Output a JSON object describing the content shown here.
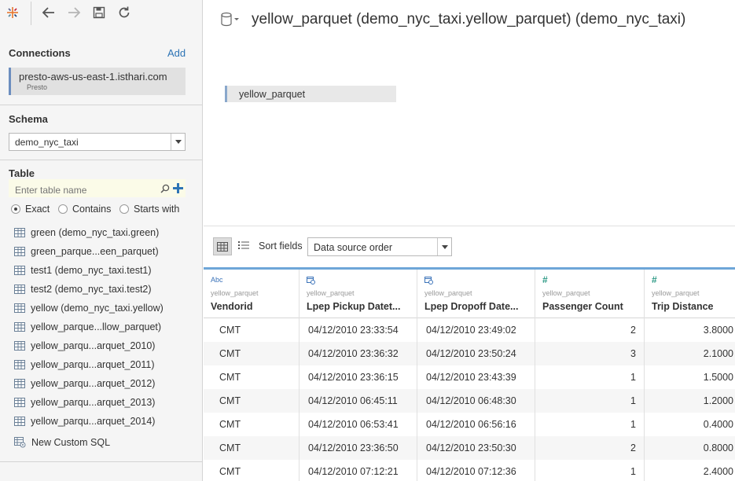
{
  "datasource_title": "yellow_parquet (demo_nyc_taxi.yellow_parquet) (demo_nyc_taxi)",
  "connections": {
    "heading": "Connections",
    "add_label": "Add",
    "items": [
      {
        "name": "presto-aws-us-east-1.isthari.com",
        "type": "Presto"
      }
    ]
  },
  "schema": {
    "heading": "Schema",
    "selected": "demo_nyc_taxi"
  },
  "table": {
    "heading": "Table",
    "search_placeholder": "Enter table name",
    "match_options": [
      "Exact",
      "Contains",
      "Starts with"
    ],
    "selected_match": "Exact",
    "items": [
      "green (demo_nyc_taxi.green)",
      "green_parque...een_parquet)",
      "test1 (demo_nyc_taxi.test1)",
      "test2 (demo_nyc_taxi.test2)",
      "yellow (demo_nyc_taxi.yellow)",
      "yellow_parque...llow_parquet)",
      "yellow_parqu...arquet_2010)",
      "yellow_parqu...arquet_2011)",
      "yellow_parqu...arquet_2012)",
      "yellow_parqu...arquet_2013)",
      "yellow_parqu...arquet_2014)"
    ],
    "custom_sql_label": "New Custom SQL"
  },
  "canvas": {
    "table_name": "yellow_parquet"
  },
  "grid": {
    "sort_label": "Sort fields",
    "sort_selected": "Data source order",
    "columns": [
      {
        "type": "Abc",
        "source": "yellow_parquet",
        "name": "Vendorid",
        "kind": "string"
      },
      {
        "type": "",
        "source": "yellow_parquet",
        "name": "Lpep Pickup Datet...",
        "kind": "datetime"
      },
      {
        "type": "",
        "source": "yellow_parquet",
        "name": "Lpep Dropoff Date...",
        "kind": "datetime"
      },
      {
        "type": "",
        "source": "yellow_parquet",
        "name": "Passenger Count",
        "kind": "number"
      },
      {
        "type": "",
        "source": "yellow_parquet",
        "name": "Trip Distance",
        "kind": "number"
      }
    ],
    "rows": [
      [
        "CMT",
        "04/12/2010 23:33:54",
        "04/12/2010 23:49:02",
        "2",
        "3.8000"
      ],
      [
        "CMT",
        "04/12/2010 23:36:32",
        "04/12/2010 23:50:24",
        "3",
        "2.1000"
      ],
      [
        "CMT",
        "04/12/2010 23:36:15",
        "04/12/2010 23:43:39",
        "1",
        "1.5000"
      ],
      [
        "CMT",
        "04/12/2010 06:45:11",
        "04/12/2010 06:48:30",
        "1",
        "1.2000"
      ],
      [
        "CMT",
        "04/12/2010 06:53:41",
        "04/12/2010 06:56:16",
        "1",
        "0.4000"
      ],
      [
        "CMT",
        "04/12/2010 23:36:50",
        "04/12/2010 23:50:30",
        "2",
        "0.8000"
      ],
      [
        "CMT",
        "04/12/2010 07:12:21",
        "04/12/2010 07:12:36",
        "1",
        "2.4000"
      ]
    ]
  }
}
